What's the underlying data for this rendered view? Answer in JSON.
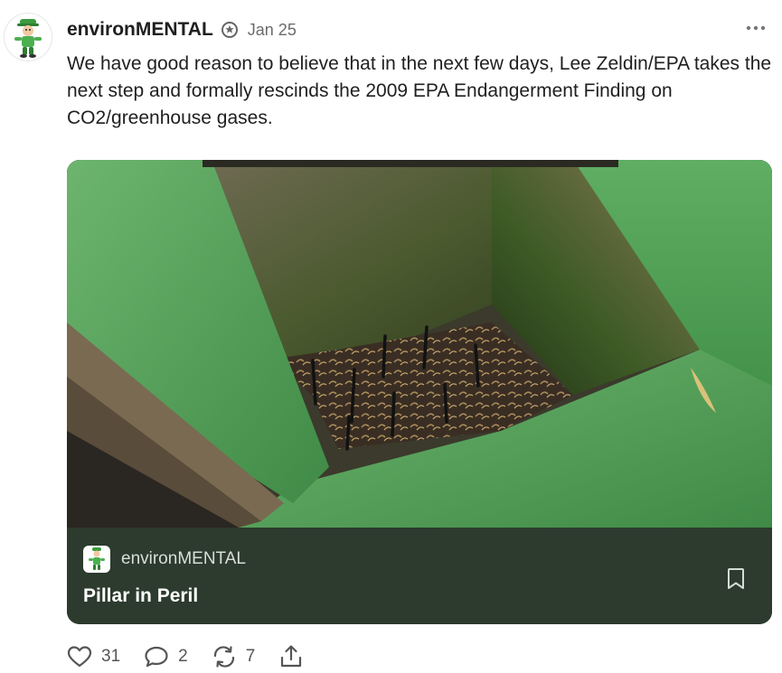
{
  "post": {
    "author": "environMENTAL",
    "date": "Jan 25",
    "text": "We have good reason to believe that in the next few days, Lee Zeldin/EPA takes the next step and formally rescinds the 2009 EPA Endangerment Finding on CO2/greenhouse gases."
  },
  "embed": {
    "publication": "environMENTAL",
    "title": "Pillar in Peril"
  },
  "actions": {
    "likes": "31",
    "comments": "2",
    "restacks": "7"
  },
  "icons": {
    "avatar": "mascot-avatar-icon",
    "verified": "verified-badge-icon",
    "more": "more-options-icon",
    "bookmark": "bookmark-icon",
    "like": "heart-icon",
    "comment": "comment-icon",
    "restack": "restack-icon",
    "share": "share-icon"
  },
  "colors": {
    "card_footer": "#2c3b2d",
    "grass": "#5aa35e"
  }
}
